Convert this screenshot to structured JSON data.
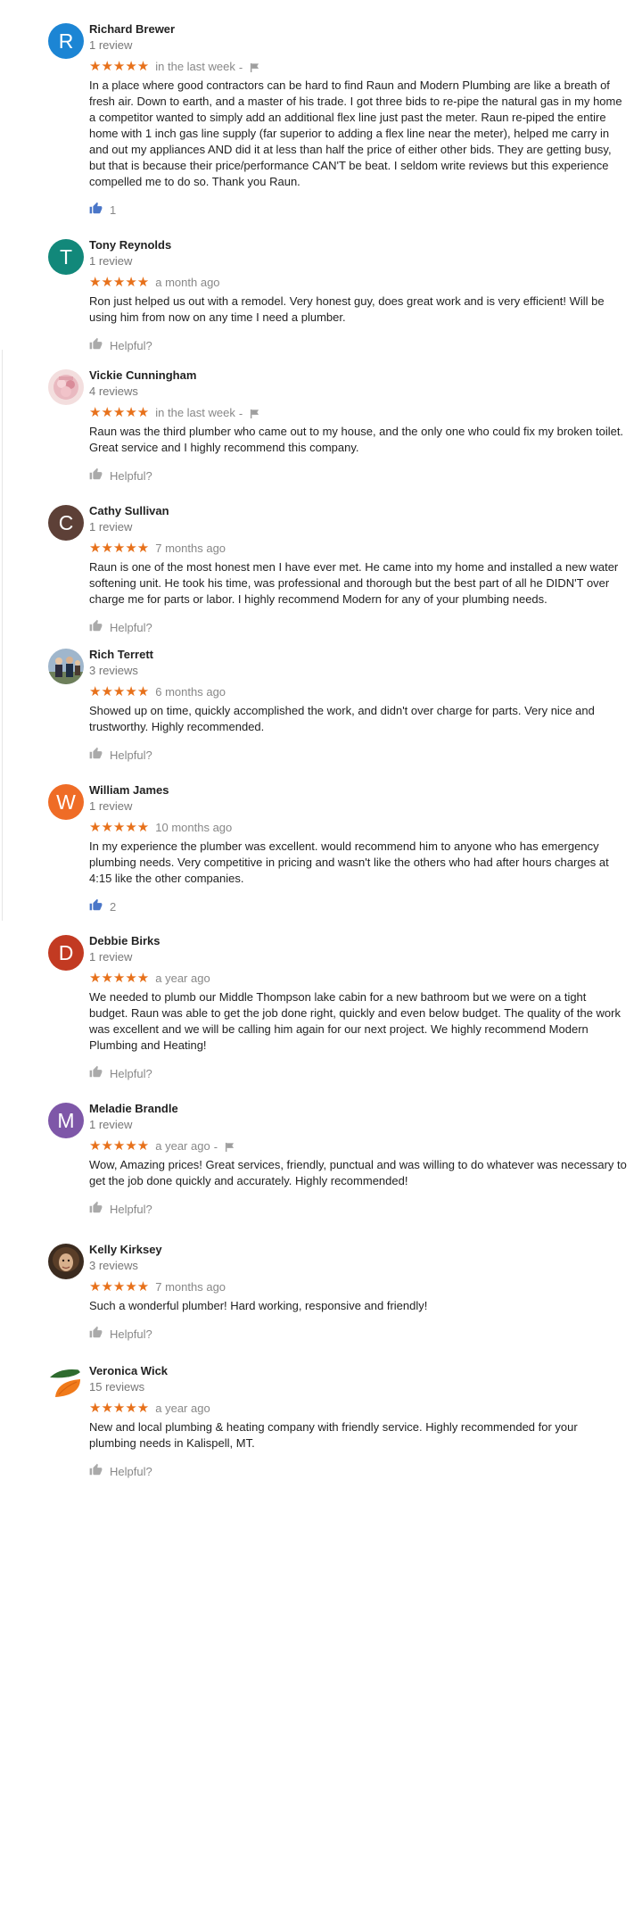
{
  "colors": {
    "star": "#e7711b",
    "thumb_active": "#4a76c8",
    "thumb_inactive": "#aaaaaa"
  },
  "reviews": [
    {
      "avatar": {
        "kind": "letter",
        "letter": "R",
        "color": "#1c85d4"
      },
      "name": "Richard Brewer",
      "count": "1 review",
      "stars": "★★★★★",
      "date": "in the last week",
      "flag": true,
      "text": "In a place where good contractors can be hard to find Raun and Modern Plumbing are like a breath of fresh air. Down to earth, and a master of his trade. I got three bids to re-pipe the natural gas in my home a competitor wanted to simply add an additional flex line just past the meter. Raun re-piped the entire home with 1 inch gas line supply (far superior to adding a flex line near the meter), helped me carry in and out my appliances AND did it at less than half the price of either other bids. They are getting busy, but that is because their price/performance CAN'T be beat. I seldom write reviews but this experience compelled me to do so. Thank you Raun.",
      "helpful": "1",
      "helpful_active": true
    },
    {
      "avatar": {
        "kind": "letter",
        "letter": "T",
        "color": "#12887a"
      },
      "name": "Tony Reynolds",
      "count": "1 review",
      "stars": "★★★★★",
      "date": "a month ago",
      "flag": false,
      "text": "Ron just helped us out with a remodel.  Very honest guy, does great work and is very efficient! Will be using him from now on any time I need a plumber.",
      "helpful": "Helpful?",
      "helpful_active": false
    },
    {
      "avatar": {
        "kind": "photo",
        "photo": "flowers"
      },
      "name": "Vickie Cunningham",
      "count": "4 reviews",
      "stars": "★★★★★",
      "date": "in the last week",
      "flag": true,
      "text": "Raun was the third plumber who came out to my house, and the only one who could fix my broken toilet. Great service and I highly recommend this company.",
      "helpful": "Helpful?",
      "helpful_active": false
    },
    {
      "avatar": {
        "kind": "letter",
        "letter": "C",
        "color": "#5d4037"
      },
      "name": "Cathy Sullivan",
      "count": "1 review",
      "stars": "★★★★★",
      "date": "7 months ago",
      "flag": false,
      "text": "Raun is one of the most honest men I have ever met. He came into my home and installed a new water softening unit.  He took his time, was professional and thorough but the best part of all he DIDN'T over charge me for parts or labor.  I highly recommend Modern for any of your plumbing needs.",
      "helpful": "Helpful?",
      "helpful_active": false
    },
    {
      "avatar": {
        "kind": "photo",
        "photo": "people"
      },
      "name": "Rich Terrett",
      "count": "3 reviews",
      "stars": "★★★★★",
      "date": "6 months ago",
      "flag": false,
      "text": "Showed up on time, quickly accomplished the work, and didn't over charge for parts.  Very nice and trustworthy.  Highly recommended.",
      "helpful": "Helpful?",
      "helpful_active": false
    },
    {
      "avatar": {
        "kind": "letter",
        "letter": "W",
        "color": "#ef6c26"
      },
      "name": "William James",
      "count": "1 review",
      "stars": "★★★★★",
      "date": "10 months ago",
      "flag": false,
      "text": "In my experience the plumber was excellent. would recommend him to anyone who has emergency plumbing needs. Very competitive in pricing and wasn't like the others who had after hours charges at 4:15 like the other companies.",
      "helpful": "2",
      "helpful_active": true
    },
    {
      "avatar": {
        "kind": "letter",
        "letter": "D",
        "color": "#c23a22"
      },
      "name": "Debbie Birks",
      "count": "1 review",
      "stars": "★★★★★",
      "date": "a year ago",
      "flag": false,
      "text": "We needed to plumb our Middle Thompson lake cabin for a new bathroom but we were on a tight budget.  Raun was able to get the job done right, quickly and even below budget.  The quality of the work was excellent and we will be calling him again for our next project.  We highly recommend Modern Plumbing and Heating!",
      "helpful": "Helpful?",
      "helpful_active": false
    },
    {
      "avatar": {
        "kind": "letter",
        "letter": "M",
        "color": "#7e57a8"
      },
      "name": "Meladie Brandle",
      "count": "1 review",
      "stars": "★★★★★",
      "date": "a year ago",
      "flag": true,
      "text": "Wow, Amazing prices! Great services, friendly, punctual and was willing to do whatever was necessary to get the job done quickly and accurately. Highly recommended!",
      "helpful": "Helpful?",
      "helpful_active": false
    },
    {
      "avatar": {
        "kind": "photo",
        "photo": "portrait"
      },
      "name": "Kelly Kirksey",
      "count": "3 reviews",
      "stars": "★★★★★",
      "date": "7 months ago",
      "flag": false,
      "text": "Such a wonderful plumber! Hard working, responsive and friendly!",
      "helpful": "Helpful?",
      "helpful_active": false
    },
    {
      "avatar": {
        "kind": "photo",
        "photo": "leaf"
      },
      "name": "Veronica Wick",
      "count": "15 reviews",
      "stars": "★★★★★",
      "date": "a year ago",
      "flag": false,
      "text": "New and local plumbing & heating company with friendly service. Highly recommended for your plumbing needs in Kalispell, MT.",
      "helpful": "Helpful?",
      "helpful_active": false
    }
  ]
}
